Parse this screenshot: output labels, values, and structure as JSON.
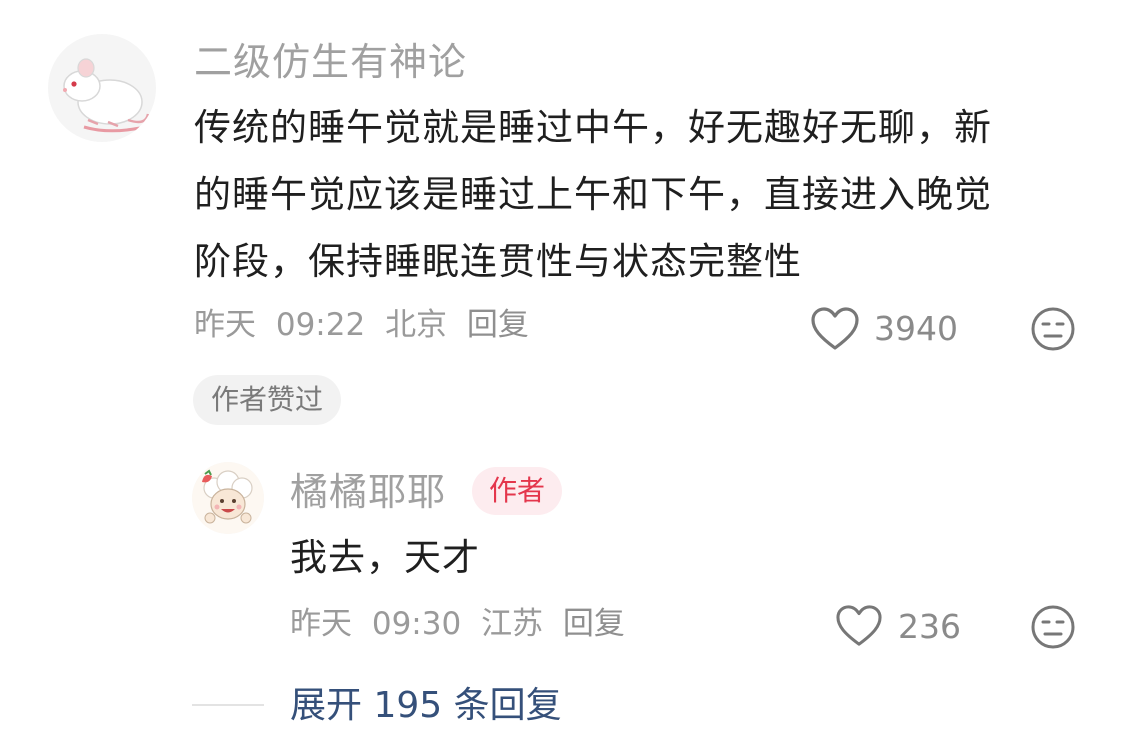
{
  "comments": [
    {
      "username": "二级仿生有神论",
      "text_lines": [
        "传统的睡午觉就是睡过中午，好无趣好无聊，新",
        "的睡午觉应该是睡过上午和下午，直接进入晚觉",
        "阶段，保持睡眠连贯性与状态完整性"
      ],
      "date": "昨天",
      "time": "09:22",
      "location": "北京",
      "reply_label": "回复",
      "likes": "3940",
      "badge": "作者赞过",
      "avatar_icon": "white-rat-icon"
    }
  ],
  "reply": {
    "username": "橘橘耶耶",
    "author_tag": "作者",
    "text": "我去，天才",
    "date": "昨天",
    "time": "09:30",
    "location": "江苏",
    "reply_label": "回复",
    "likes": "236",
    "avatar_icon": "cartoon-sheep-icon"
  },
  "expand_label": "展开 195 条回复",
  "icons": {
    "like": "heart-outline-icon",
    "react": "neutral-face-icon"
  },
  "colors": {
    "author_tag_text": "#e4364c",
    "author_tag_bg": "#fdecef",
    "expand_text": "#35507a"
  }
}
